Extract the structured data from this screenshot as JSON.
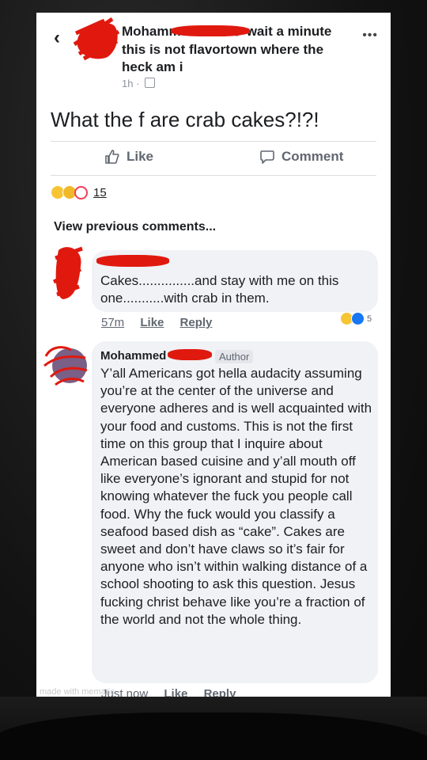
{
  "post": {
    "author": "Mohammed",
    "headline": "wait a minute this is not flavortown where the heck am i",
    "time": "1h",
    "text": "What the f are crab cakes?!?!",
    "like_label": "Like",
    "comment_label": "Comment",
    "reaction_count": "15"
  },
  "view_previous": "View previous comments...",
  "comments": [
    {
      "text": "Cakes...............and stay with me on this one...........with crab in them.",
      "time": "57m",
      "like": "Like",
      "reply": "Reply",
      "reaction_count": "5"
    },
    {
      "author": "Mohammed",
      "badge": "Author",
      "text": "Y’all Americans got hella audacity assuming you’re at the center of the universe and everyone adheres and is well acquainted with your food and customs. This is not the first time on this group that I inquire about American based cuisine and y’all mouth off like everyone’s ignorant and stupid for not knowing whatever the fuck you people call food. Why the fuck would you classify a seafood based dish as “cake”. Cakes are sweet and don’t have claws so it’s fair for anyone who isn’t within walking distance of a school shooting to ask this question. Jesus fucking christ behave like you’re a fraction of the world and not the whole thing.",
      "time": "Just now",
      "like": "Like",
      "reply": "Reply"
    }
  ],
  "watermark": "made with mematic",
  "icons": {
    "back": "back-chevron-icon",
    "more": "more-icon",
    "like": "thumbs-up-icon",
    "comment": "speech-bubble-icon",
    "globe": "audience-icon"
  },
  "colors": {
    "redaction": "#e0190f",
    "bubble": "#f0f2f5",
    "meta": "#606770"
  }
}
